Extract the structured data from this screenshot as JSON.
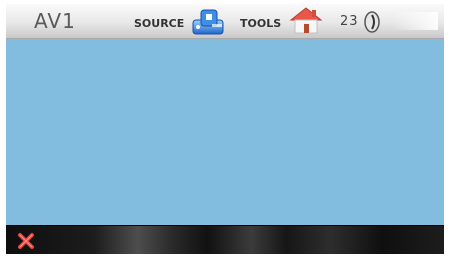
{
  "header": {
    "source_title": "AV1",
    "source_label": "SOURCE",
    "tools_label": "TOOLS",
    "volume_value": "23"
  },
  "icons": {
    "source": "source-icon",
    "home": "home-icon",
    "volume": "volume-icon",
    "close": "close-icon"
  },
  "colors": {
    "screen_background": "#82bde0",
    "close_icon": "#e3433c",
    "home_roof": "#e9574a"
  }
}
